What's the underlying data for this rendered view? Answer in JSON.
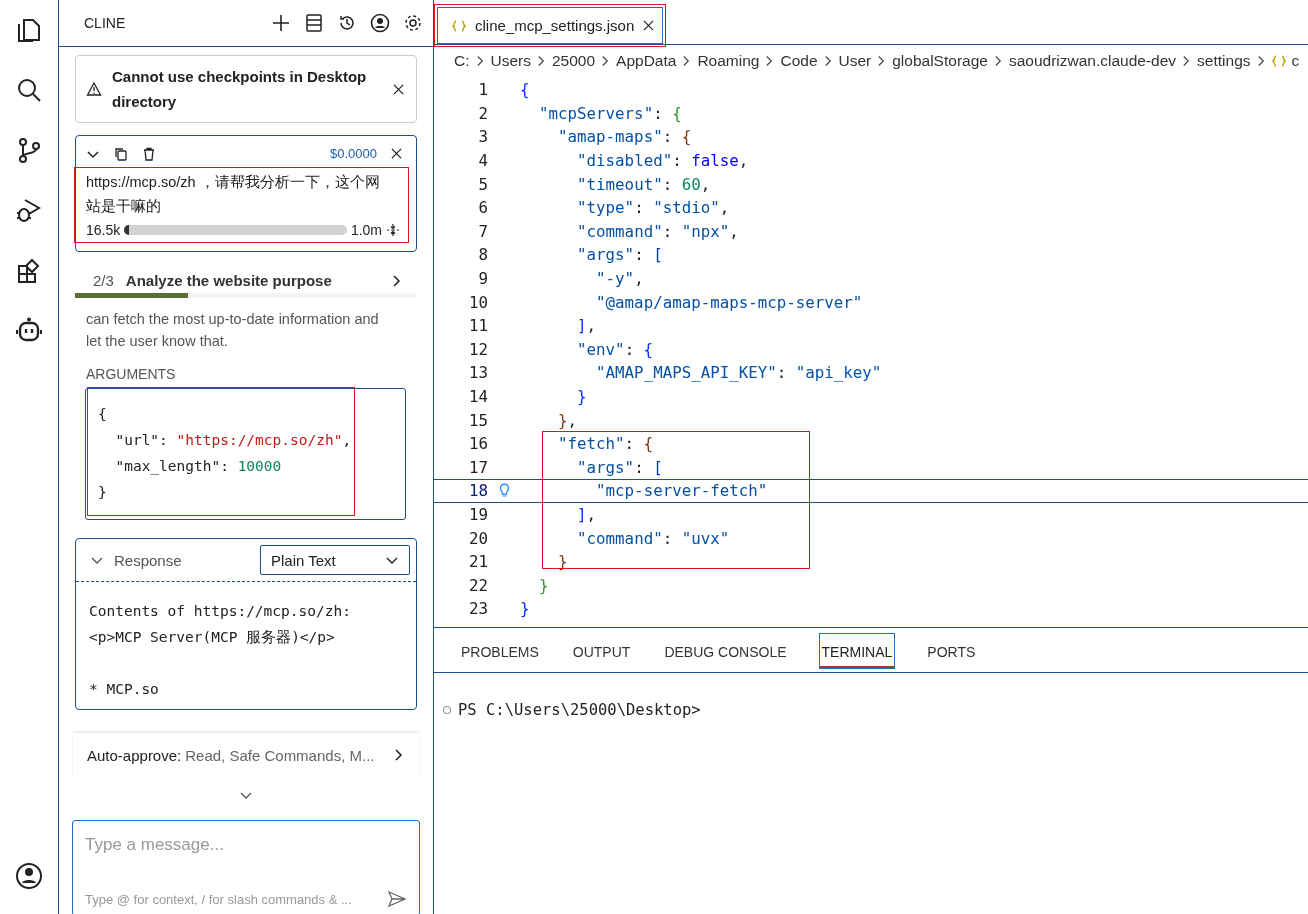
{
  "sidebar": {
    "title": "CLINE",
    "warning": {
      "text": "Cannot use checkpoints in Desktop directory"
    },
    "task": {
      "cost": "$0.0000",
      "text": "https://mcp.so/zh ，请帮我分析一下，这个网站是干嘛的",
      "tokens_in": "16.5k",
      "level": 0.02,
      "tokens_max": "1.0m"
    },
    "step": {
      "counter": "2/3",
      "title": "Analyze the website purpose",
      "level": 0.33
    },
    "description": "can fetch the most up-to-date information and let the user know that.",
    "arguments": {
      "label": "ARGUMENTS",
      "lines": [
        [
          {
            "kind": "open",
            "text": "{"
          }
        ],
        [
          {
            "kind": "key",
            "text": "\"url\""
          },
          {
            "kind": "punct",
            "text": ":"
          },
          {
            "kind": "str",
            "text": "\"https://mcp.so/zh\""
          },
          {
            "kind": "punct",
            "text": ","
          }
        ],
        [
          {
            "kind": "key",
            "text": "\"max_length\""
          },
          {
            "kind": "punct",
            "text": ":"
          },
          {
            "kind": "num",
            "text": "10000"
          }
        ],
        [
          {
            "kind": "close",
            "text": "}"
          }
        ]
      ]
    },
    "response": {
      "label": "Response",
      "expanded": true,
      "format": "Plain Text",
      "paragraphs": [
        [
          "Contents of https://mcp.so/zh:",
          "<p>MCP Server(MCP 服务器)</p>"
        ],
        [
          "* MCP.so"
        ]
      ]
    },
    "auto_approve": {
      "label": "Auto-approve:",
      "value": "Read, Safe Commands, M..."
    },
    "input": {
      "placeholder": "Type a message...",
      "hint": "Type @ for context, / for slash commands & ..."
    }
  },
  "editor": {
    "tabs": [
      {
        "label": "cline_mcp_settings.json",
        "selected": true
      }
    ],
    "breadcrumbs": [
      "C:",
      "Users",
      "25000",
      "AppData",
      "Roaming",
      "Code",
      "User",
      "globalStorage",
      "saoudrizwan.claude-dev",
      "settings",
      "c"
    ],
    "lines": [
      {
        "number": "1",
        "current": false,
        "tokens": [
          {
            "kind": "open",
            "text": "{"
          }
        ]
      },
      {
        "number": "2",
        "current": false,
        "tokens": [
          {
            "kind": "key",
            "text": "\"mcpServers\""
          },
          {
            "kind": "punct",
            "text": ":"
          },
          {
            "kind": "open",
            "text": "{"
          }
        ]
      },
      {
        "number": "3",
        "current": false,
        "tokens": [
          {
            "kind": "key",
            "text": "\"amap-maps\""
          },
          {
            "kind": "punct",
            "text": ":"
          },
          {
            "kind": "open",
            "text": "{"
          }
        ]
      },
      {
        "number": "4",
        "current": false,
        "tokens": [
          {
            "kind": "key",
            "text": "\"disabled\""
          },
          {
            "kind": "punct",
            "text": ":"
          },
          {
            "kind": "bool",
            "text": "false"
          },
          {
            "kind": "punct",
            "text": ","
          }
        ]
      },
      {
        "number": "5",
        "current": false,
        "tokens": [
          {
            "kind": "key",
            "text": "\"timeout\""
          },
          {
            "kind": "punct",
            "text": ":"
          },
          {
            "kind": "num",
            "text": "60"
          },
          {
            "kind": "punct",
            "text": ","
          }
        ]
      },
      {
        "number": "6",
        "current": false,
        "tokens": [
          {
            "kind": "key",
            "text": "\"type\""
          },
          {
            "kind": "punct",
            "text": ":"
          },
          {
            "kind": "str",
            "text": "\"stdio\""
          },
          {
            "kind": "punct",
            "text": ","
          }
        ]
      },
      {
        "number": "7",
        "current": false,
        "tokens": [
          {
            "kind": "key",
            "text": "\"command\""
          },
          {
            "kind": "punct",
            "text": ":"
          },
          {
            "kind": "str",
            "text": "\"npx\""
          },
          {
            "kind": "punct",
            "text": ","
          }
        ]
      },
      {
        "number": "8",
        "current": false,
        "tokens": [
          {
            "kind": "key",
            "text": "\"args\""
          },
          {
            "kind": "punct",
            "text": ":"
          },
          {
            "kind": "open",
            "text": "["
          }
        ]
      },
      {
        "number": "9",
        "current": false,
        "tokens": [
          {
            "kind": "str",
            "text": "\"-y\""
          },
          {
            "kind": "punct",
            "text": ","
          }
        ]
      },
      {
        "number": "10",
        "current": false,
        "tokens": [
          {
            "kind": "str",
            "text": "\"@amap/amap-maps-mcp-server\""
          }
        ]
      },
      {
        "number": "11",
        "current": false,
        "tokens": [
          {
            "kind": "close",
            "text": "]"
          },
          {
            "kind": "punct",
            "text": ","
          }
        ]
      },
      {
        "number": "12",
        "current": false,
        "tokens": [
          {
            "kind": "key",
            "text": "\"env\""
          },
          {
            "kind": "punct",
            "text": ":"
          },
          {
            "kind": "open",
            "text": "{"
          }
        ]
      },
      {
        "number": "13",
        "current": false,
        "tokens": [
          {
            "kind": "key",
            "text": "\"AMAP_MAPS_API_KEY\""
          },
          {
            "kind": "punct",
            "text": ":"
          },
          {
            "kind": "str",
            "text": "\"api_key\""
          }
        ]
      },
      {
        "number": "14",
        "current": false,
        "tokens": [
          {
            "kind": "close",
            "text": "}"
          }
        ]
      },
      {
        "number": "15",
        "current": false,
        "tokens": [
          {
            "kind": "close",
            "text": "}"
          },
          {
            "kind": "punct",
            "text": ","
          }
        ]
      },
      {
        "number": "16",
        "current": false,
        "tokens": [
          {
            "kind": "key",
            "text": "\"fetch\""
          },
          {
            "kind": "punct",
            "text": ":"
          },
          {
            "kind": "open",
            "text": "{"
          }
        ]
      },
      {
        "number": "17",
        "current": false,
        "tokens": [
          {
            "kind": "key",
            "text": "\"args\""
          },
          {
            "kind": "punct",
            "text": ":"
          },
          {
            "kind": "open",
            "text": "["
          }
        ]
      },
      {
        "number": "18",
        "current": true,
        "tokens": [
          {
            "kind": "str",
            "text": "\"mcp-server-fetch\""
          }
        ]
      },
      {
        "number": "19",
        "current": false,
        "tokens": [
          {
            "kind": "close",
            "text": "]"
          },
          {
            "kind": "punct",
            "text": ","
          }
        ]
      },
      {
        "number": "20",
        "current": false,
        "tokens": [
          {
            "kind": "key",
            "text": "\"command\""
          },
          {
            "kind": "punct",
            "text": ":"
          },
          {
            "kind": "str",
            "text": "\"uvx\""
          }
        ]
      },
      {
        "number": "21",
        "current": false,
        "tokens": [
          {
            "kind": "close",
            "text": "}"
          }
        ]
      },
      {
        "number": "22",
        "current": false,
        "tokens": [
          {
            "kind": "close",
            "text": "}"
          }
        ]
      },
      {
        "number": "23",
        "current": false,
        "tokens": [
          {
            "kind": "close",
            "text": "}"
          }
        ]
      }
    ]
  },
  "panel": {
    "tabs": [
      {
        "label": "PROBLEMS",
        "selected": false
      },
      {
        "label": "OUTPUT",
        "selected": false
      },
      {
        "label": "DEBUG CONSOLE",
        "selected": false
      },
      {
        "label": "TERMINAL",
        "selected": true
      },
      {
        "label": "PORTS",
        "selected": false
      }
    ],
    "prompt": "PS C:\\Users\\25000\\Desktop>"
  }
}
